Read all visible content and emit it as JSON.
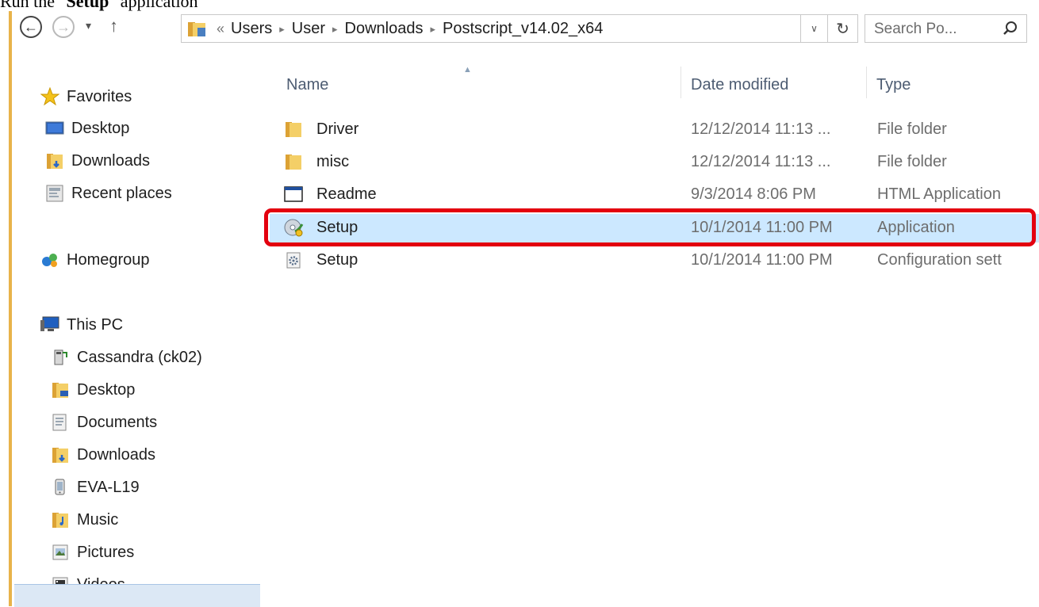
{
  "caption": {
    "prefix": "Run the \"",
    "bold": "Setup",
    "suffix": "\" application"
  },
  "navbar": {
    "back_glyph": "←",
    "forward_glyph": "→",
    "recent_glyph": "▾",
    "up_glyph": "↑",
    "overflow_glyph": "«",
    "separator_glyph": "▸",
    "breadcrumbs": [
      "Users",
      "User",
      "Downloads",
      "Postscript_v14.02_x64"
    ],
    "dropdown_glyph": "∨",
    "refresh_glyph": "↻",
    "search_placeholder": "Search Po..."
  },
  "sidebar": {
    "favorites": {
      "label": "Favorites",
      "icon": "star-icon"
    },
    "favorite_items": [
      {
        "label": "Desktop",
        "icon": "desktop-icon"
      },
      {
        "label": "Downloads",
        "icon": "downloads-folder-icon"
      },
      {
        "label": "Recent places",
        "icon": "recent-places-icon"
      }
    ],
    "homegroup": {
      "label": "Homegroup",
      "icon": "homegroup-icon"
    },
    "this_pc": {
      "label": "This PC",
      "icon": "computer-icon"
    },
    "pc_items": [
      {
        "label": "Cassandra (ck02)",
        "icon": "network-drive-icon"
      },
      {
        "label": "Desktop",
        "icon": "desktop-folder-icon"
      },
      {
        "label": "Documents",
        "icon": "documents-folder-icon"
      },
      {
        "label": "Downloads",
        "icon": "downloads-folder-icon"
      },
      {
        "label": "EVA-L19",
        "icon": "phone-device-icon"
      },
      {
        "label": "Music",
        "icon": "music-folder-icon"
      },
      {
        "label": "Pictures",
        "icon": "pictures-folder-icon"
      },
      {
        "label": "Videos",
        "icon": "videos-folder-icon"
      }
    ]
  },
  "list": {
    "columns": {
      "name": "Name",
      "date": "Date modified",
      "type": "Type"
    },
    "rows": [
      {
        "name": "Driver",
        "date": "12/12/2014 11:13 ...",
        "type": "File folder",
        "icon": "folder-icon",
        "selected": false
      },
      {
        "name": "misc",
        "date": "12/12/2014 11:13 ...",
        "type": "File folder",
        "icon": "folder-icon",
        "selected": false
      },
      {
        "name": "Readme",
        "date": "9/3/2014 8:06 PM",
        "type": "HTML Application",
        "icon": "html-application-icon",
        "selected": false
      },
      {
        "name": "Setup",
        "date": "10/1/2014 11:00 PM",
        "type": "Application",
        "icon": "setup-application-icon",
        "selected": true
      },
      {
        "name": "Setup",
        "date": "10/1/2014 11:00 PM",
        "type": "Configuration sett",
        "icon": "configuration-settings-icon",
        "selected": false
      }
    ]
  },
  "colors": {
    "selection": "#cce8ff",
    "highlight_border": "#e3000f",
    "folder": "#e8b84a",
    "accent_rule": "#e8b34a"
  }
}
